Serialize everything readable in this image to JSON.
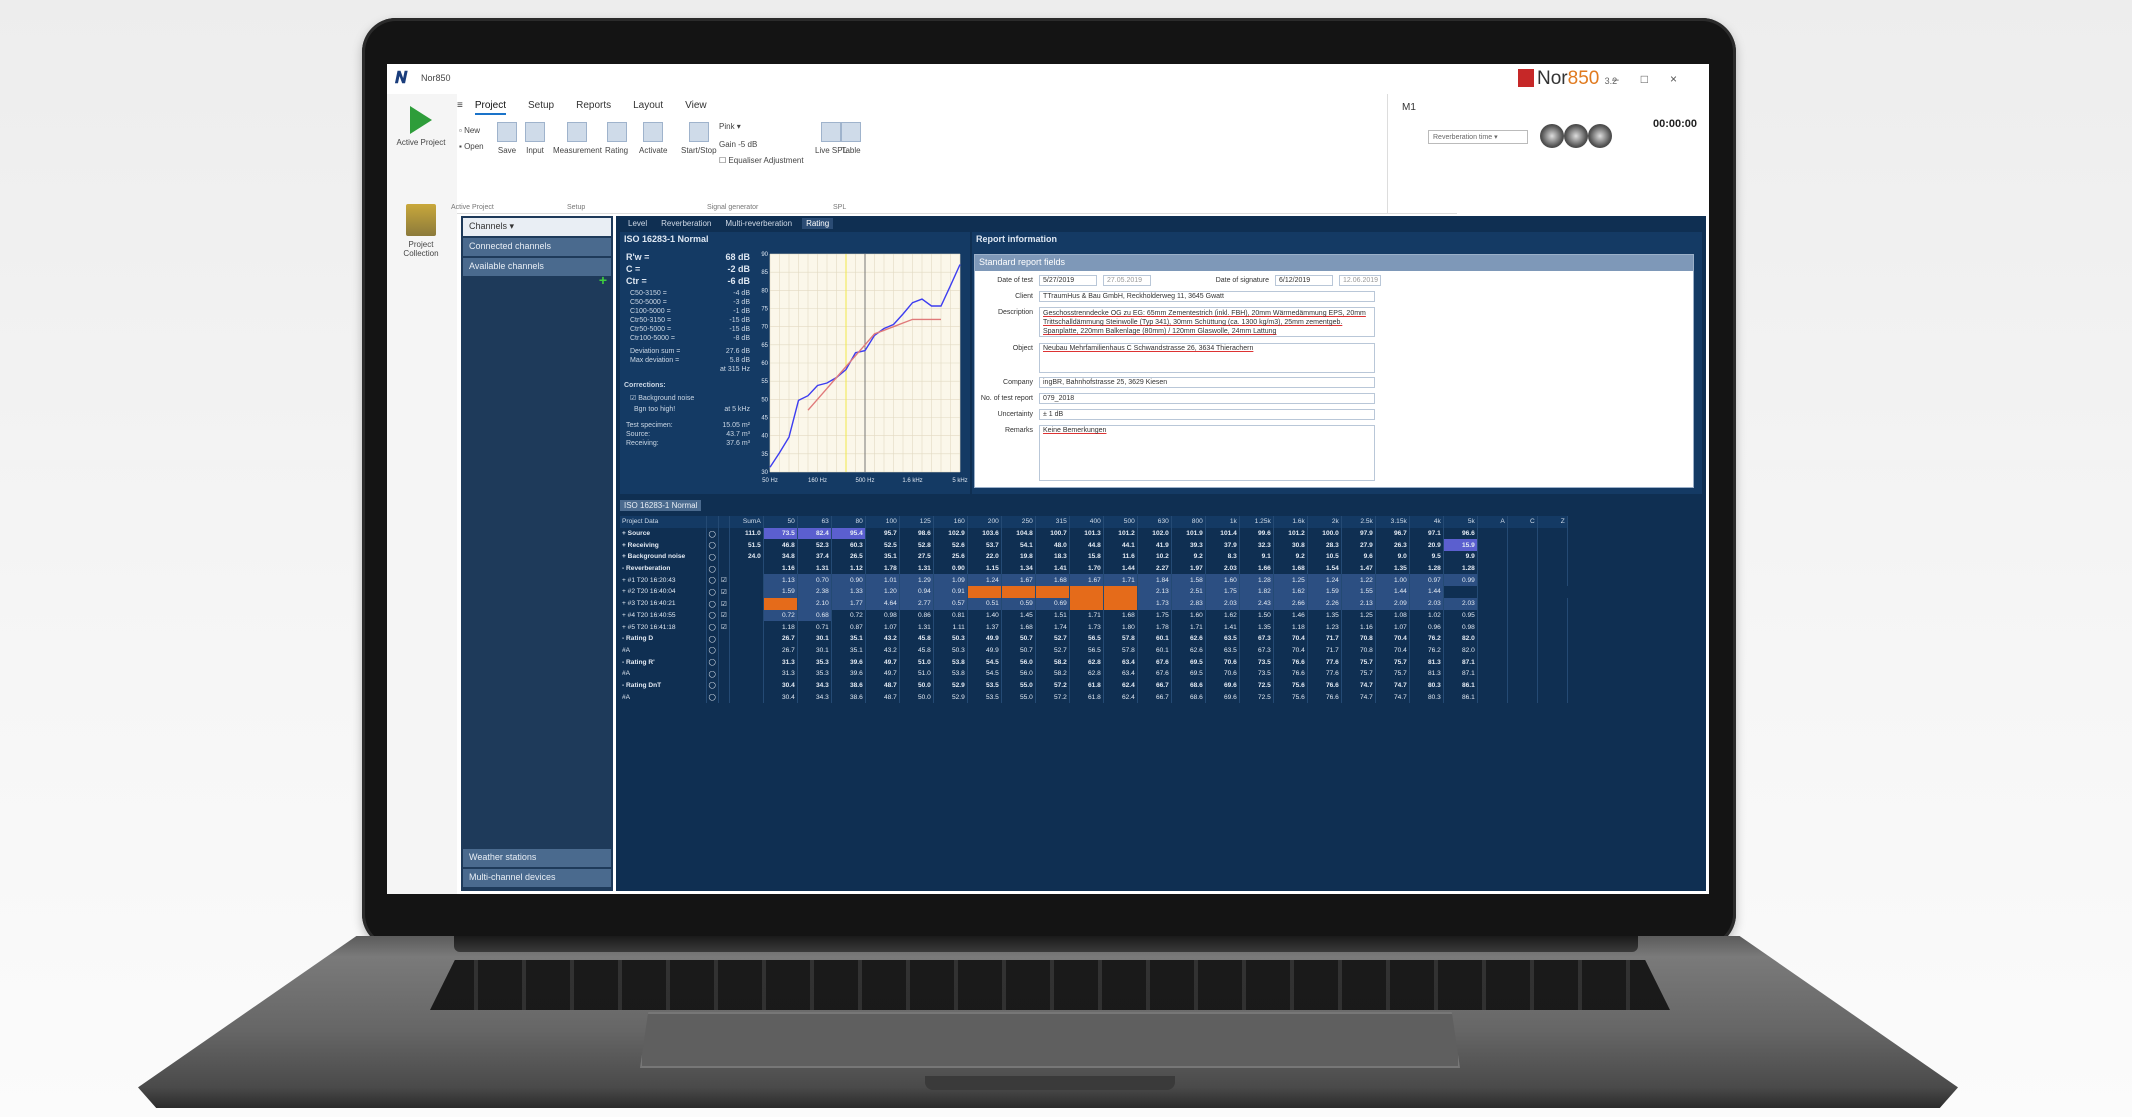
{
  "window": {
    "title": "Nor850",
    "brand": "Nor",
    "brand_accent": "850",
    "version": "3.2",
    "min": "–",
    "max": "□",
    "close": "×"
  },
  "left_panel": {
    "active_project": "Active Project",
    "project_collection": "Project Collection"
  },
  "ribbon": {
    "tabs": [
      "Project",
      "Setup",
      "Reports",
      "Layout",
      "View"
    ],
    "buttons": {
      "new": "New",
      "open": "Open",
      "save": "Save",
      "input": "Input",
      "measurement": "Measurement",
      "rating": "Rating",
      "activate": "Activate",
      "start_stop": "Start/Stop",
      "gain": "Gain",
      "level_spl": "Live SPL",
      "table": "Table"
    },
    "generator": {
      "signal": "Pink",
      "gain_value": "-5",
      "gain_unit": "dB",
      "equalizer": "Equaliser Adjustment"
    },
    "groups": [
      "Active Project",
      "Setup",
      "Signal generator",
      "SPL"
    ]
  },
  "right_bar": {
    "channel": "M1",
    "dropdown": "Reverberation time",
    "timer": "00:00:00"
  },
  "sidebar": {
    "channels": "Channels",
    "connected": "Connected channels",
    "available": "Available channels",
    "weather": "Weather stations",
    "multichannel": "Multi-channel devices"
  },
  "main_tabs": [
    "Level",
    "Reverberation",
    "Multi-reverberation",
    "Rating"
  ],
  "results": {
    "title": "ISO 16283-1 Normal",
    "rw": {
      "label": "R'w =",
      "value": "68 dB"
    },
    "c": {
      "label": "C =",
      "value": "-2 dB"
    },
    "ctr": {
      "label": "Ctr =",
      "value": "-6 dB"
    },
    "terms": [
      {
        "k": "C50-3150 =",
        "v": "-4 dB"
      },
      {
        "k": "C50-5000 =",
        "v": "-3 dB"
      },
      {
        "k": "C100-5000 =",
        "v": "-1 dB"
      },
      {
        "k": "Ctr50-3150 =",
        "v": "-15 dB"
      },
      {
        "k": "Ctr50-5000 =",
        "v": "-15 dB"
      },
      {
        "k": "Ctr100-5000 =",
        "v": "-8 dB"
      }
    ],
    "deviation_sum": {
      "k": "Deviation sum =",
      "v": "27.6 dB"
    },
    "max_deviation": {
      "k": "Max deviation =",
      "v": "5.8 dB"
    },
    "at": "at 315 Hz",
    "corrections": "Corrections:",
    "background_noise": "Background noise",
    "bgn_too_high": "Bgn too high!",
    "bgn_at": "at 5 kHz",
    "specimen": {
      "k": "Test specimen:",
      "v": "15.05 m²"
    },
    "source": {
      "k": "Source:",
      "v": "43.7 m³"
    },
    "receiving": {
      "k": "Receiving:",
      "v": "37.6 m³"
    }
  },
  "chart_data": {
    "type": "line",
    "x": [
      "50",
      "63",
      "80",
      "100",
      "125",
      "160",
      "200",
      "250",
      "315",
      "400",
      "500",
      "630",
      "800",
      "1k",
      "1.25k",
      "1.6k",
      "2k",
      "2.5k",
      "3.15k",
      "4k",
      "5k"
    ],
    "x_tick_labels": [
      "50 Hz",
      "160 Hz",
      "500 Hz",
      "1.6 kHz",
      "5 kHz"
    ],
    "y_ticks": [
      30,
      35,
      40,
      45,
      50,
      55,
      60,
      65,
      70,
      75,
      80,
      85,
      90
    ],
    "ylim": [
      30,
      90
    ],
    "series": [
      {
        "color": "#3d3df0",
        "values": [
          31.3,
          35.3,
          39.6,
          49.7,
          51.0,
          53.8,
          54.5,
          56.0,
          58.2,
          62.8,
          63.4,
          67.6,
          69.5,
          70.6,
          73.5,
          76.6,
          77.6,
          75.7,
          75.7,
          81.3,
          87.1
        ]
      },
      {
        "color": "#e07a7a",
        "values": [
          null,
          null,
          null,
          null,
          47.0,
          50.0,
          53.0,
          56.0,
          59.0,
          62.0,
          65.0,
          68.0,
          69.0,
          70.0,
          71.0,
          72.0,
          72.0,
          72.0,
          72.0,
          null,
          null
        ]
      }
    ],
    "markers": [
      {
        "x": "315",
        "color": "#f2e94a"
      },
      {
        "x": "500",
        "color": "#777"
      }
    ]
  },
  "report": {
    "header": "Report information",
    "section": "Standard report fields",
    "date_of_test_label": "Date of test",
    "date_of_test": "5/27/2019",
    "date_of_test_alt": "27.05.2019",
    "date_of_signature_label": "Date of signature",
    "date_of_signature": "6/12/2019",
    "date_of_signature_alt": "12.06.2019",
    "client_label": "Client",
    "client": "TTraumHus & Bau GmbH, Reckholderweg 11, 3645 Gwatt",
    "description_label": "Description",
    "description": "Geschosstrenndecke OG zu EG: 65mm Zementestrich (inkl. FBH), 20mm Wärmedämmung EPS, 20mm Trittschalldämmung Steinwolle (Typ 341), 30mm Schüttung (ca. 1300 kg/m3), 25mm zementgeb. Spanplatte, 220mm Balkenlage (80mm) / 120mm Glaswolle, 24mm Lattung",
    "object_label": "Object",
    "object": "Neubau Mehrfamilienhaus C Schwandstrasse 26, 3634 Thierachern",
    "company_label": "Company",
    "company": "ingBR, Bahnhofstrasse 25, 3629 Kiesen",
    "test_report_label": "No. of test report",
    "test_report": "079_2018",
    "uncertainty_label": "Uncertainty",
    "uncertainty": "± 1 dB",
    "remarks_label": "Remarks",
    "remarks": "Keine Bemerkungen"
  },
  "table": {
    "tab": "ISO 16283-1 Normal",
    "header": [
      "Project Data",
      "",
      "",
      "SumA",
      "50",
      "63",
      "80",
      "100",
      "125",
      "160",
      "200",
      "250",
      "315",
      "400",
      "500",
      "630",
      "800",
      "1k",
      "1.25k",
      "1.6k",
      "2k",
      "2.5k",
      "3.15k",
      "4k",
      "5k",
      "A",
      "C",
      "Z"
    ],
    "rows": [
      {
        "name": "+ Source",
        "bold": true,
        "cells": [
          "111.0",
          "73.5",
          "82.4",
          "95.4",
          "95.7",
          "98.6",
          "102.9",
          "103.6",
          "104.8",
          "100.7",
          "101.3",
          "101.2",
          "102.0",
          "101.9",
          "101.4",
          "99.6",
          "101.2",
          "100.0",
          "97.9",
          "96.7",
          "97.1",
          "96.6"
        ]
      },
      {
        "name": "+ Receiving",
        "bold": true,
        "cells": [
          "51.5",
          "46.8",
          "52.3",
          "60.3",
          "52.5",
          "52.8",
          "52.6",
          "53.7",
          "54.1",
          "48.0",
          "44.8",
          "44.1",
          "41.9",
          "39.3",
          "37.9",
          "32.3",
          "30.8",
          "28.3",
          "27.9",
          "26.3",
          "20.9",
          "15.9"
        ]
      },
      {
        "name": "+ Background noise",
        "bold": true,
        "cells": [
          "24.0",
          "34.8",
          "37.4",
          "26.5",
          "35.1",
          "27.5",
          "25.6",
          "22.0",
          "19.8",
          "18.3",
          "15.8",
          "11.6",
          "10.2",
          "9.2",
          "8.3",
          "9.1",
          "9.2",
          "10.5",
          "9.6",
          "9.0",
          "9.5",
          "9.9"
        ]
      },
      {
        "name": "- Reverberation",
        "bold": true,
        "cells": [
          "",
          "1.16",
          "1.31",
          "1.12",
          "1.78",
          "1.31",
          "0.90",
          "1.15",
          "1.34",
          "1.41",
          "1.70",
          "1.44",
          "2.27",
          "1.97",
          "2.03",
          "1.66",
          "1.68",
          "1.54",
          "1.47",
          "1.35",
          "1.28",
          "1.28"
        ]
      },
      {
        "name": "+ #1 T20  16:20:43",
        "bold": false,
        "cells": [
          "",
          "1.13",
          "0.70",
          "0.90",
          "1.01",
          "1.29",
          "1.09",
          "1.24",
          "1.67",
          "1.68",
          "1.67",
          "1.71",
          "1.84",
          "1.58",
          "1.60",
          "1.28",
          "1.25",
          "1.24",
          "1.22",
          "1.00",
          "0.97",
          "0.99"
        ]
      },
      {
        "name": "+ #2 T20  16:40:04",
        "bold": false,
        "cells": [
          "",
          "1.59",
          "2.38",
          "1.33",
          "1.20",
          "0.94",
          "0.91",
          "",
          "",
          "",
          "",
          "",
          "2.13",
          "2.51",
          "1.75",
          "1.82",
          "1.62",
          "1.59",
          "1.55",
          "1.44",
          "1.44"
        ]
      },
      {
        "name": "+ #3 T20  16:40:21",
        "bold": false,
        "cells": [
          "",
          "",
          "2.10",
          "1.77",
          "4.64",
          "2.77",
          "0.57",
          "0.51",
          "0.59",
          "0.69",
          "",
          "",
          "1.73",
          "2.83",
          "2.03",
          "2.43",
          "2.66",
          "2.26",
          "2.13",
          "2.09",
          "2.03",
          "2.03"
        ]
      },
      {
        "name": "+ #4 T20  16:40:55",
        "bold": false,
        "cells": [
          "",
          "0.72",
          "0.68",
          "0.72",
          "0.98",
          "0.86",
          "0.81",
          "1.40",
          "1.45",
          "1.51",
          "1.71",
          "1.68",
          "1.75",
          "1.60",
          "1.62",
          "1.50",
          "1.46",
          "1.35",
          "1.25",
          "1.08",
          "1.02",
          "0.95"
        ]
      },
      {
        "name": "+ #5 T20  16:41:18",
        "bold": false,
        "cells": [
          "",
          "1.18",
          "0.71",
          "0.87",
          "1.07",
          "1.31",
          "1.11",
          "1.37",
          "1.68",
          "1.74",
          "1.73",
          "1.80",
          "1.78",
          "1.71",
          "1.41",
          "1.35",
          "1.18",
          "1.23",
          "1.16",
          "1.07",
          "0.96",
          "0.98"
        ]
      },
      {
        "name": "- Rating D",
        "bold": true,
        "cells": [
          "",
          "26.7",
          "30.1",
          "35.1",
          "43.2",
          "45.8",
          "50.3",
          "49.9",
          "50.7",
          "52.7",
          "56.5",
          "57.8",
          "60.1",
          "62.6",
          "63.5",
          "67.3",
          "70.4",
          "71.7",
          "70.8",
          "70.4",
          "76.2",
          "82.0"
        ]
      },
      {
        "name": "  #A",
        "bold": false,
        "cells": [
          "",
          "26.7",
          "30.1",
          "35.1",
          "43.2",
          "45.8",
          "50.3",
          "49.9",
          "50.7",
          "52.7",
          "56.5",
          "57.8",
          "60.1",
          "62.6",
          "63.5",
          "67.3",
          "70.4",
          "71.7",
          "70.8",
          "70.4",
          "76.2",
          "82.0"
        ]
      },
      {
        "name": "- Rating R'",
        "bold": true,
        "cells": [
          "",
          "31.3",
          "35.3",
          "39.6",
          "49.7",
          "51.0",
          "53.8",
          "54.5",
          "56.0",
          "58.2",
          "62.8",
          "63.4",
          "67.6",
          "69.5",
          "70.6",
          "73.5",
          "76.6",
          "77.6",
          "75.7",
          "75.7",
          "81.3",
          "87.1"
        ]
      },
      {
        "name": "  #A",
        "bold": false,
        "cells": [
          "",
          "31.3",
          "35.3",
          "39.6",
          "49.7",
          "51.0",
          "53.8",
          "54.5",
          "56.0",
          "58.2",
          "62.8",
          "63.4",
          "67.6",
          "69.5",
          "70.6",
          "73.5",
          "76.6",
          "77.6",
          "75.7",
          "75.7",
          "81.3",
          "87.1"
        ]
      },
      {
        "name": "- Rating DnT",
        "bold": true,
        "cells": [
          "",
          "30.4",
          "34.3",
          "38.6",
          "48.7",
          "50.0",
          "52.9",
          "53.5",
          "55.0",
          "57.2",
          "61.8",
          "62.4",
          "66.7",
          "68.6",
          "69.6",
          "72.5",
          "75.6",
          "76.6",
          "74.7",
          "74.7",
          "80.3",
          "86.1"
        ]
      },
      {
        "name": "  #A",
        "bold": false,
        "cells": [
          "",
          "30.4",
          "34.3",
          "38.6",
          "48.7",
          "50.0",
          "52.9",
          "53.5",
          "55.0",
          "57.2",
          "61.8",
          "62.4",
          "66.7",
          "68.6",
          "69.6",
          "72.5",
          "75.6",
          "76.6",
          "74.7",
          "74.7",
          "80.3",
          "86.1"
        ]
      }
    ]
  }
}
